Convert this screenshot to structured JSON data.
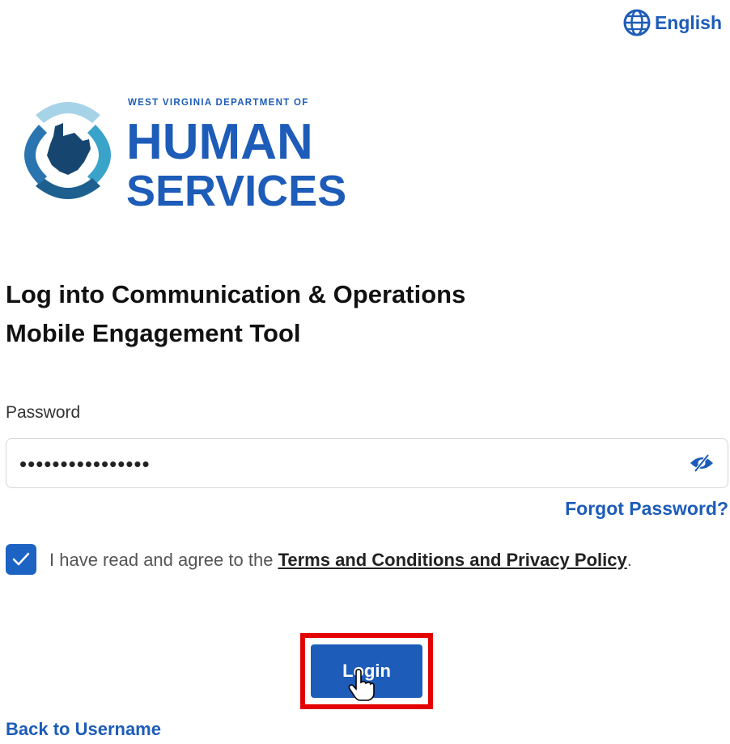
{
  "language": {
    "icon": "globe-icon",
    "label": "English"
  },
  "logo": {
    "line1": "WEST VIRGINIA DEPARTMENT OF",
    "line2": "HUMAN",
    "line3": "SERVICES"
  },
  "title": {
    "line1": "Log into Communication & Operations",
    "line2": "Mobile Engagement Tool"
  },
  "password": {
    "label": "Password",
    "value": "••••••••••••••••",
    "toggle_icon": "eye-slash-icon"
  },
  "forgot_label": "Forgot Password?",
  "agreement": {
    "checked": true,
    "text": "I have read and agree to the",
    "link": "Terms and Conditions and Privacy Policy",
    "end": "."
  },
  "login_label": "Login",
  "back_label": "Back to Username",
  "colors": {
    "accent": "#1d5cb8",
    "highlight": "#e50000"
  }
}
